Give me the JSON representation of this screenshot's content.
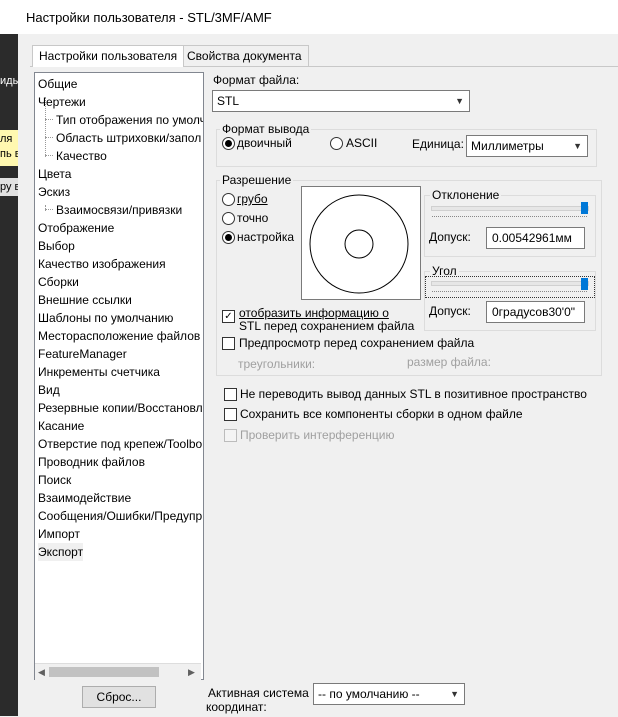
{
  "window": {
    "title": "Настройки пользователя - STL/3MF/AMF"
  },
  "left_strip": {
    "frag1": "иды",
    "frag2": "ля",
    "frag3": "пь в",
    "frag4": "ру вы"
  },
  "tabs": [
    {
      "label": "Настройки пользователя",
      "active": true
    },
    {
      "label": "Свойства документа",
      "active": false
    }
  ],
  "tree": {
    "items": [
      {
        "label": "Общие",
        "level": 0
      },
      {
        "label": "Чертежи",
        "level": 0
      },
      {
        "label": "Тип отображения по умолч",
        "level": 1
      },
      {
        "label": "Область штриховки/запол",
        "level": 1
      },
      {
        "label": "Качество",
        "level": 1
      },
      {
        "label": "Цвета",
        "level": 0
      },
      {
        "label": "Эскиз",
        "level": 0
      },
      {
        "label": "Взаимосвязи/привязки",
        "level": 1
      },
      {
        "label": "Отображение",
        "level": 0
      },
      {
        "label": "Выбор",
        "level": 0
      },
      {
        "label": "Качество изображения",
        "level": 0
      },
      {
        "label": "Сборки",
        "level": 0
      },
      {
        "label": "Внешние ссылки",
        "level": 0
      },
      {
        "label": "Шаблоны по умолчанию",
        "level": 0
      },
      {
        "label": "Месторасположение файлов",
        "level": 0
      },
      {
        "label": "FeatureManager",
        "level": 0
      },
      {
        "label": "Инкременты счетчика",
        "level": 0
      },
      {
        "label": "Вид",
        "level": 0
      },
      {
        "label": "Резервные копии/Восстановл",
        "level": 0
      },
      {
        "label": "Касание",
        "level": 0
      },
      {
        "label": "Отверстие под крепеж/Toolbo",
        "level": 0
      },
      {
        "label": "Проводник файлов",
        "level": 0
      },
      {
        "label": "Поиск",
        "level": 0
      },
      {
        "label": "Взаимодействие",
        "level": 0
      },
      {
        "label": "Сообщения/Ошибки/Предупр",
        "level": 0
      },
      {
        "label": "Импорт",
        "level": 0
      },
      {
        "label": "Экспорт",
        "level": 0,
        "selected": true
      }
    ]
  },
  "file_format": {
    "label": "Формат файла:",
    "value": "STL"
  },
  "output_format": {
    "group_label": "Формат вывода",
    "binary_label": "двоичный",
    "ascii_label": "ASCII",
    "selected": "binary",
    "units_label": "Единица:",
    "units_value": "Миллиметры"
  },
  "resolution": {
    "group_label": "Разрешение",
    "coarse_label": "грубо",
    "fine_label": "точно",
    "custom_label": "настройка",
    "selected": "custom",
    "deviation": {
      "label": "Отклонение",
      "tolerance_label": "Допуск:",
      "tolerance_value": "0.00542961мм",
      "level": 1.0
    },
    "angle": {
      "label": "Угол",
      "tolerance_label": "Допуск:",
      "tolerance_value": "0градусов30'0\"",
      "level": 1.0
    },
    "show_info": {
      "label_line1": "отобразить информацию о",
      "label_line2": "STL перед сохранением файла",
      "checked": true
    },
    "preview": {
      "label": "Предпросмотр перед сохранением файла",
      "checked": false
    },
    "triangles_label": "треугольники:",
    "filesize_label": "размер файла:"
  },
  "options": {
    "no_positive_space": {
      "label": "Не переводить вывод данных STL в позитивное пространство",
      "checked": false
    },
    "save_all_components": {
      "label": "Сохранить все компоненты сборки в одном файле",
      "checked": false
    },
    "check_interference": {
      "label": "Проверить интерференцию",
      "checked": false,
      "disabled": true
    }
  },
  "reset_button": {
    "label": "Сброс..."
  },
  "coord_system": {
    "label_line1": "Активная система",
    "label_line2": "координат:",
    "value": "-- по умолчанию --"
  },
  "colors": {
    "accent": "#0078d7",
    "selection_bg": "#f0f0f0",
    "panel_bg": "#f0f0f0"
  }
}
